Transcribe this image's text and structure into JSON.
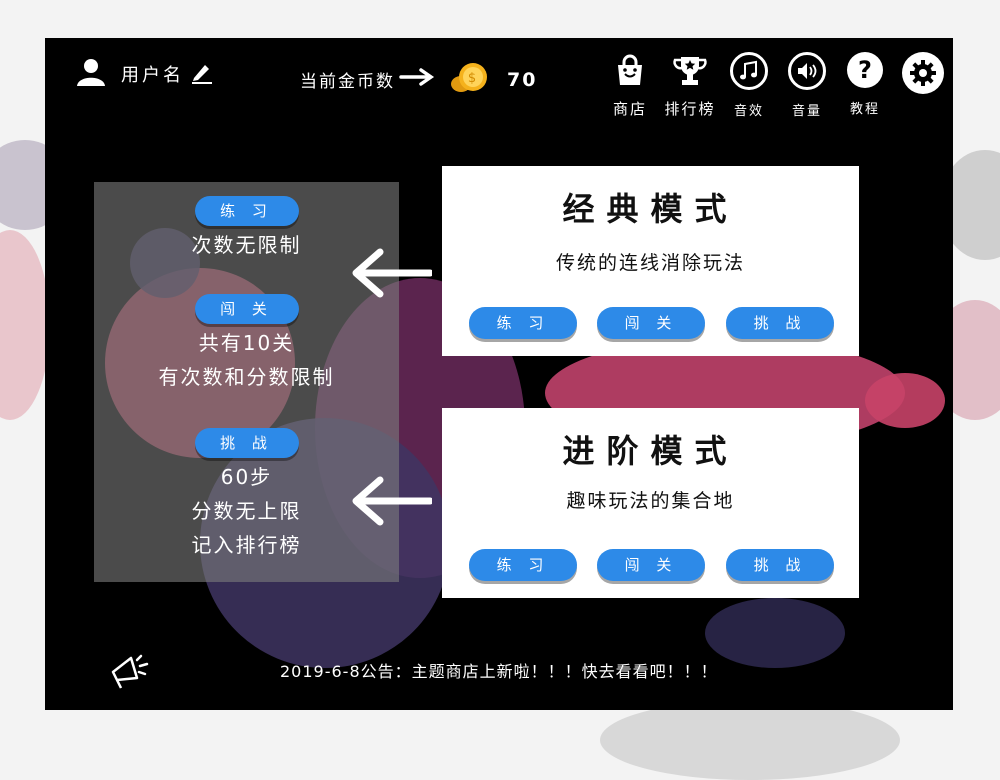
{
  "header": {
    "username": "用户名",
    "coins_label": "当前金币数",
    "coins_value": "70"
  },
  "toolbar": {
    "shop": "商店",
    "leaderboard": "排行榜",
    "sound_effects": "音效",
    "volume": "音量",
    "tutorial": "教程"
  },
  "info_panel": {
    "practice": {
      "label": "练 习",
      "lines": [
        "次数无限制"
      ]
    },
    "levels": {
      "label": "闯 关",
      "lines": [
        "共有10关",
        "有次数和分数限制"
      ]
    },
    "challenge": {
      "label": "挑 战",
      "lines": [
        "60步",
        "分数无上限",
        "记入排行榜"
      ]
    }
  },
  "modes": [
    {
      "title": "经典模式",
      "description": "传统的连线消除玩法",
      "buttons": [
        "练 习",
        "闯 关",
        "挑 战"
      ]
    },
    {
      "title": "进阶模式",
      "description": "趣味玩法的集合地",
      "buttons": [
        "练 习",
        "闯 关",
        "挑 战"
      ]
    }
  ],
  "announcement": "2019-6-8公告：主题商店上新啦！！！快去看看吧！！！",
  "colors": {
    "button_blue": "#2d8ae8",
    "coin_gold": "#f5b21c",
    "background": "#000000",
    "panel_gray": "#7d7d7d"
  },
  "icons": [
    "user-icon",
    "edit-icon",
    "arrow-right-icon",
    "coins-icon",
    "shop-bag-icon",
    "trophy-icon",
    "music-note-icon",
    "speaker-icon",
    "help-icon",
    "settings-gear-icon",
    "megaphone-icon",
    "arrow-left-icon"
  ]
}
